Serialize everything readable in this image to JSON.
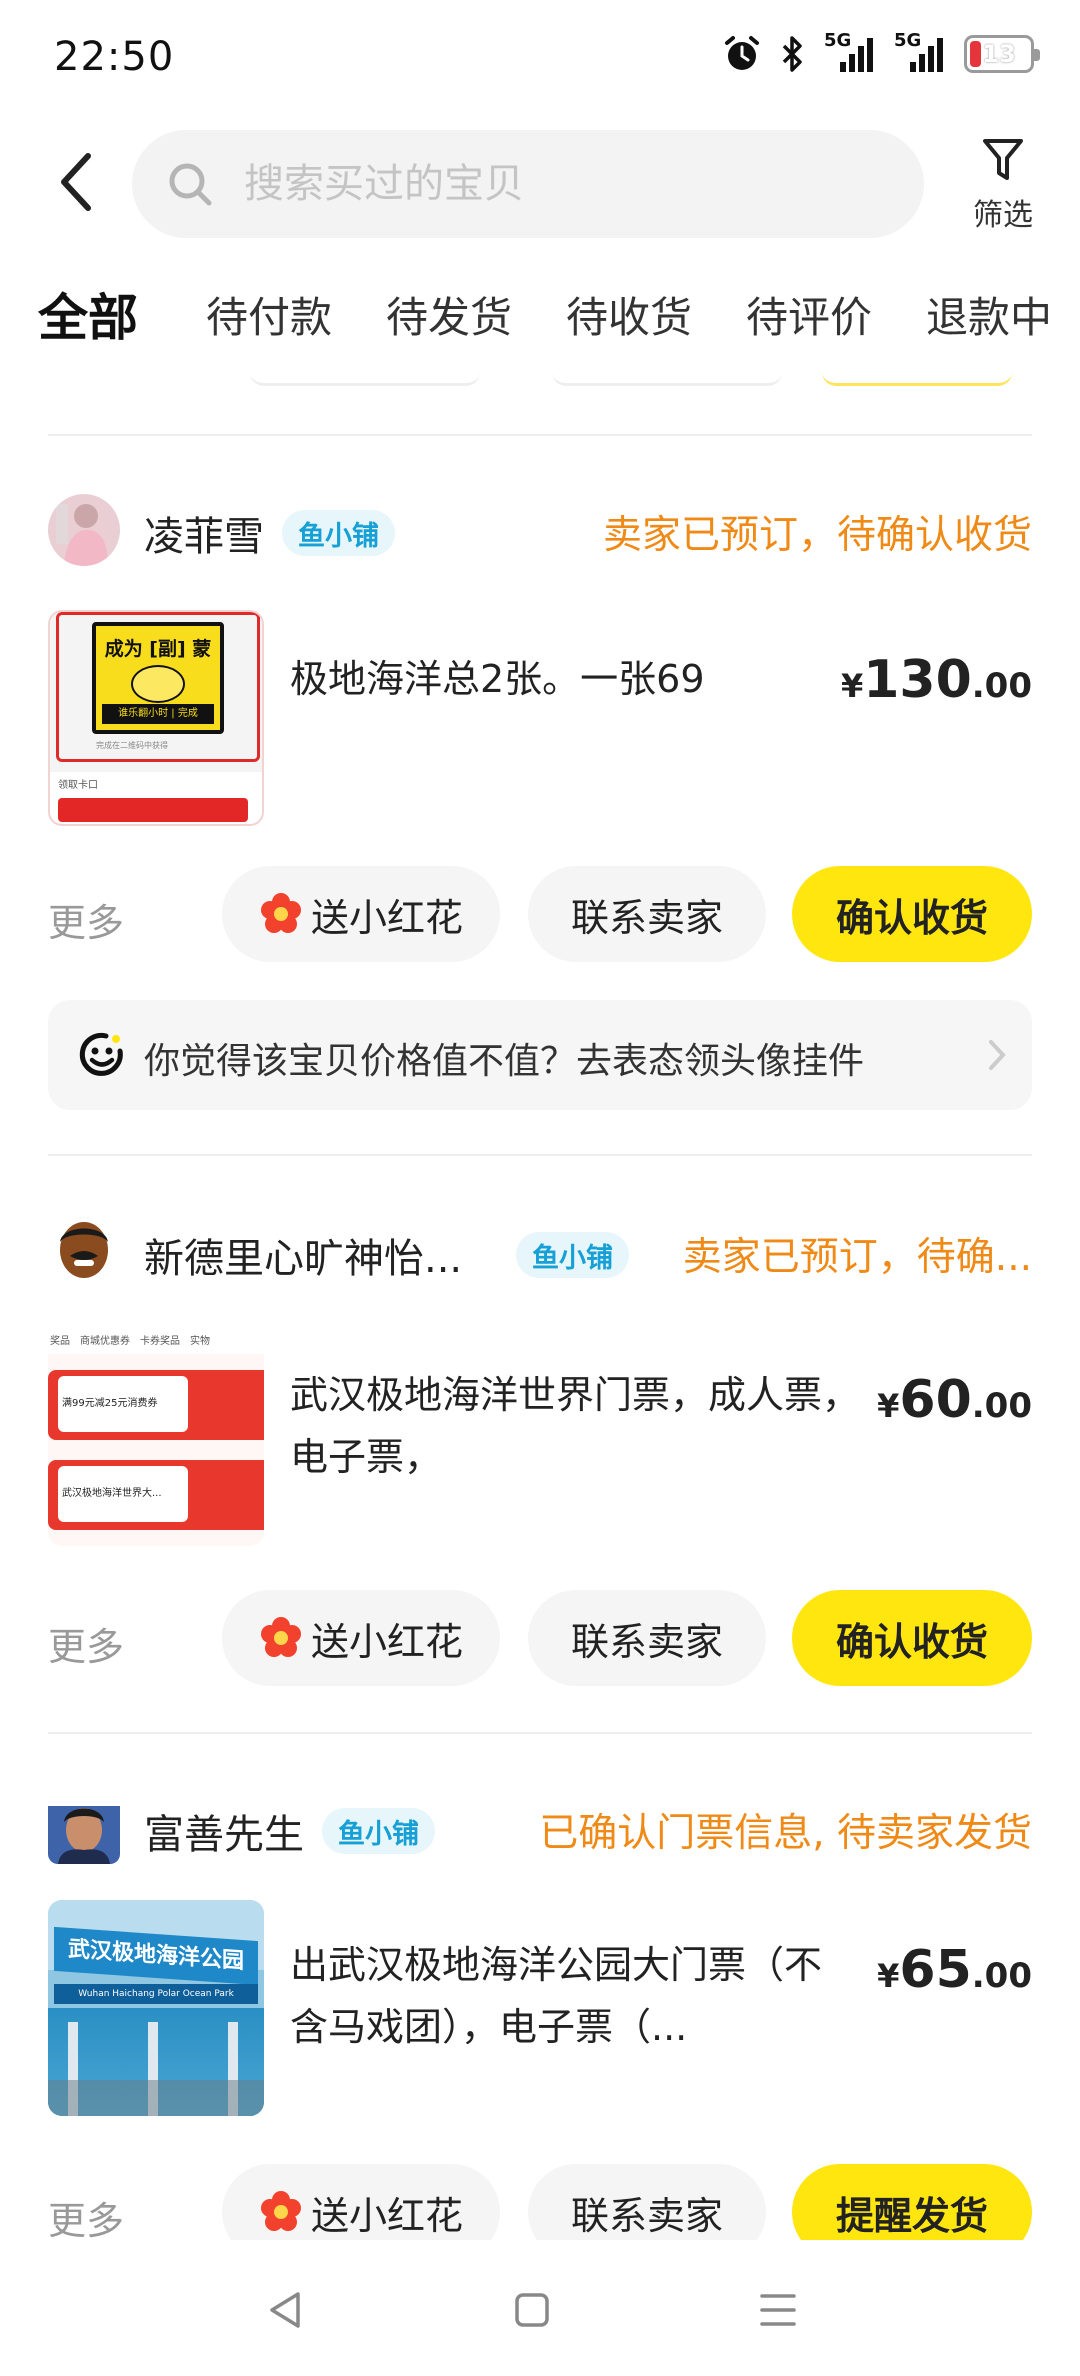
{
  "status_bar": {
    "time": "22:50",
    "signal1": "5G",
    "signal2": "5G",
    "battery": "13",
    "colors": {
      "battery_low": "#e5343c"
    }
  },
  "header": {
    "back_icon": "chevron-left-icon",
    "search_placeholder": "搜索买过的宝贝",
    "search_value": "",
    "filter_label": "筛选"
  },
  "tabs": [
    {
      "label": "全部",
      "active": true
    },
    {
      "label": "待付款",
      "active": false
    },
    {
      "label": "待发货",
      "active": false
    },
    {
      "label": "待收货",
      "active": false
    },
    {
      "label": "待评价",
      "active": false
    },
    {
      "label": "退款中",
      "active": false
    }
  ],
  "orders": [
    {
      "shop_name": "凌菲雪",
      "shop_badge": "鱼小铺",
      "status": "卖家已预订，待确认收货",
      "item_title": "极地海洋总2张。一张69",
      "price_currency": "¥",
      "price_int": "130",
      "price_dec": ".00",
      "more_label": "更多",
      "btn_flower": "送小红花",
      "btn_contact": "联系卖家",
      "btn_primary": "确认收货",
      "thumb": {
        "title": "成为 [副] 蒙",
        "subtitle": "谁乐翻小时 | 完成",
        "caption": "完成在二维码中获得",
        "footer": "领取卡口"
      }
    },
    {
      "shop_name": "新德里心旷神怡...",
      "shop_badge": "鱼小铺",
      "status": "卖家已预订，待确...",
      "item_title": "武汉极地海洋世界门票，成人票，电子票，",
      "price_currency": "¥",
      "price_int": "60",
      "price_dec": ".00",
      "more_label": "更多",
      "btn_flower": "送小红花",
      "btn_contact": "联系卖家",
      "btn_primary": "确认收货",
      "thumb": {
        "tabs": [
          "奖品",
          "商城优惠券",
          "卡券奖品",
          "实物"
        ],
        "coupon1": "满99元减25元消费券",
        "coupon2": "武汉极地海洋世界大..."
      }
    },
    {
      "shop_name": "富善先生",
      "shop_badge": "鱼小铺",
      "status": "已确认门票信息, 待卖家发货",
      "item_title": "出武汉极地海洋公园大门票（不含马戏团），电子票（...",
      "price_currency": "¥",
      "price_int": "65",
      "price_dec": ".00",
      "more_label": "更多",
      "btn_flower": "送小红花",
      "btn_contact": "联系卖家",
      "btn_primary": "提醒发货",
      "thumb": {
        "sign_cn": "武汉极地海洋公园",
        "sign_en": "Wuhan Haichang Polar Ocean Park"
      }
    }
  ],
  "hint": {
    "text": "你觉得该宝贝价格值不值？去表态领头像挂件",
    "icon": "smiley-icon"
  },
  "nav_bar": {
    "back": "triangle-back-icon",
    "home": "square-home-icon",
    "menu": "menu-lines-icon"
  }
}
